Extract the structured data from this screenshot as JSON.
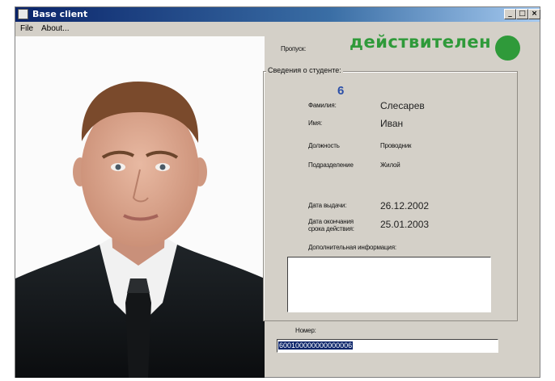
{
  "window": {
    "title": "Base client",
    "controls": {
      "minimize": "_",
      "maximize": "□",
      "close": "×"
    }
  },
  "menu": {
    "file": "File",
    "about": "About..."
  },
  "pass": {
    "label": "Пропуск:",
    "status": "действителен",
    "indicator_color": "#2f9a3a"
  },
  "student": {
    "group_label": "Сведения о студенте:",
    "id": "6",
    "surname_label": "Фамилия:",
    "surname": "Слесарев",
    "name_label": "Имя:",
    "name": "Иван",
    "position_label": "Должность",
    "position": "Проводник",
    "department_label": "Подразделение",
    "department": "Жилой",
    "issue_date_label": "Дата выдачи:",
    "issue_date": "26.12.2002",
    "expiry_label_1": "Дата окончания",
    "expiry_label_2": "срока действия:",
    "expiry_date": "25.01.2003",
    "extra_info_label": "Дополнительная информация:",
    "extra_info": ""
  },
  "number": {
    "label": "Номер:",
    "value": "600100000000000006"
  }
}
